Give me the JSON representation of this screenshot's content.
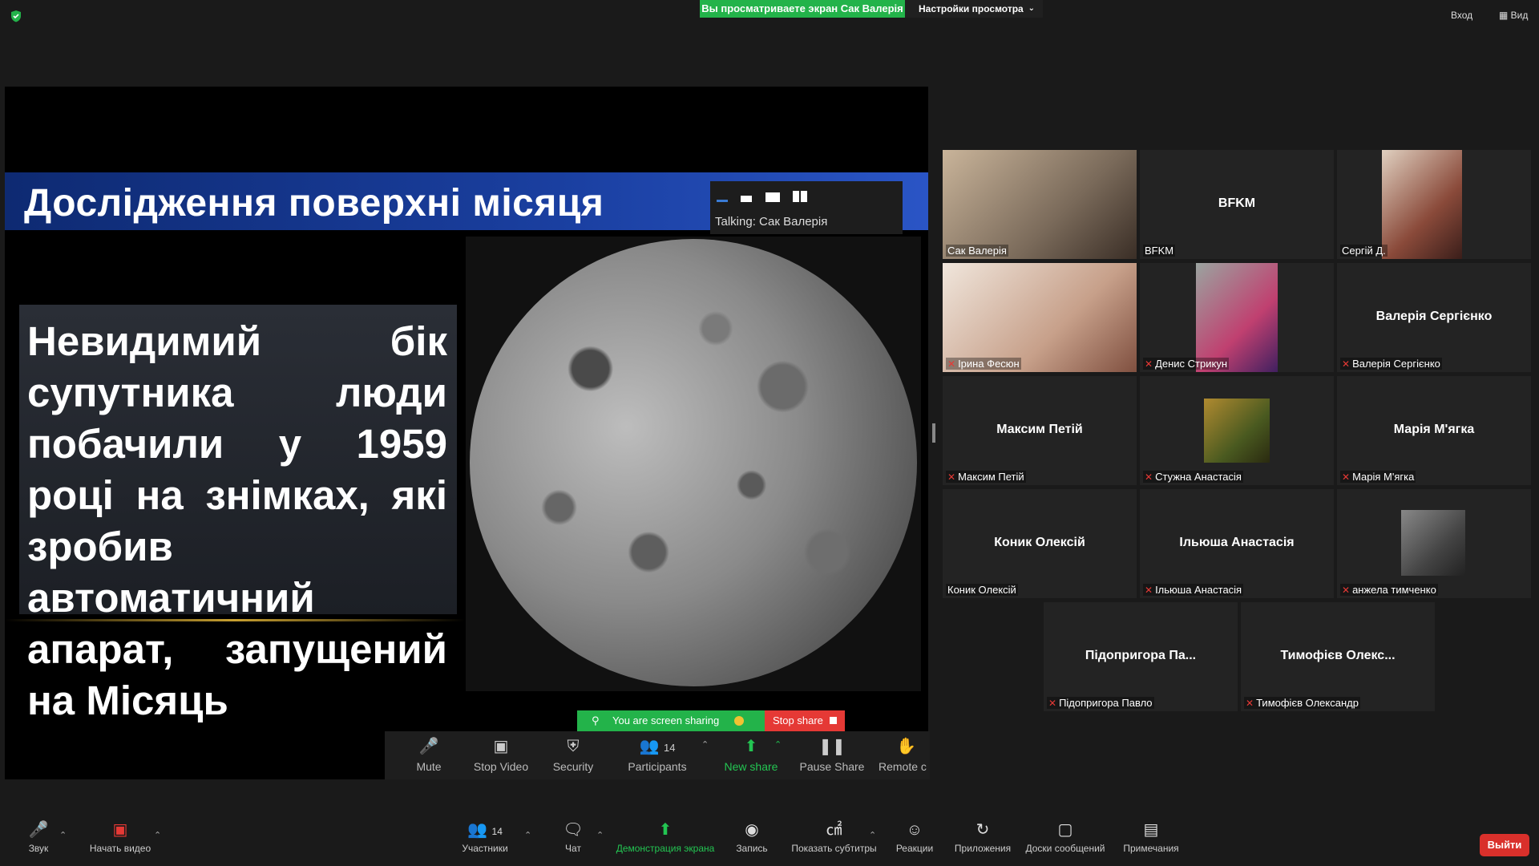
{
  "top": {
    "viewing_banner": "Вы просматриваете экран Сак Валерія",
    "view_options": "Настройки просмотра",
    "exit_fullscreen": "Вход",
    "view": "Вид"
  },
  "slide": {
    "title": "Дослідження поверхні місяця",
    "body": "Невидимий бік супутника люди побачили у 1959 році на знімках, які зробив автоматичний апарат, запущений на Місяць",
    "talking": "Talking: Сак Валерія"
  },
  "share_controls": {
    "sharing_text": "You are screen sharing",
    "stop_share": "Stop share",
    "participants_count": "14",
    "items": [
      "Mute",
      "Stop Video",
      "Security",
      "Participants",
      "New share",
      "Pause Share",
      "Remote c"
    ]
  },
  "gallery": [
    {
      "name": "Сак Валерія",
      "center_name": "",
      "muted": false,
      "video": true,
      "active": true
    },
    {
      "name": "BFKM",
      "center_name": "BFKM",
      "muted": false,
      "video": false,
      "active": false
    },
    {
      "name": "Сергій Д.",
      "center_name": "",
      "muted": false,
      "video": true,
      "active": false
    },
    {
      "name": "Ірина Фесюн",
      "center_name": "",
      "muted": true,
      "video": true,
      "active": false
    },
    {
      "name": "Денис Стрикун",
      "center_name": "",
      "muted": true,
      "video": true,
      "active": false
    },
    {
      "name": "Валерія Сергієнко",
      "center_name": "Валерія Сергієнко",
      "muted": true,
      "video": false,
      "active": false
    },
    {
      "name": "Максим Петій",
      "center_name": "Максим Петій",
      "muted": true,
      "video": false,
      "active": false
    },
    {
      "name": "Стужна Анастасія",
      "center_name": "",
      "muted": true,
      "video": true,
      "active": false
    },
    {
      "name": "Марія М'ягка",
      "center_name": "Марія М'ягка",
      "muted": true,
      "video": false,
      "active": false
    },
    {
      "name": "Коник Олексій",
      "center_name": "Коник Олексій",
      "muted": false,
      "video": false,
      "active": false
    },
    {
      "name": "Ільюша Анастасія",
      "center_name": "Ільюша Анастасія",
      "muted": true,
      "video": false,
      "active": false
    },
    {
      "name": "анжела тимченко",
      "center_name": "",
      "muted": true,
      "video": true,
      "active": false
    },
    {
      "name": "Підопригора Павло",
      "center_name": "Підопригора Па...",
      "muted": true,
      "video": false,
      "active": false
    },
    {
      "name": "Тимофієв Олександр",
      "center_name": "Тимофієв Олекс...",
      "muted": true,
      "video": false,
      "active": false
    }
  ],
  "bottom": {
    "audio": "Звук",
    "video": "Начать видео",
    "participants": "Участники",
    "participants_count": "14",
    "chat": "Чат",
    "share": "Демонстрация экрана",
    "record": "Запись",
    "captions": "Показать субтитры",
    "reactions": "Реакции",
    "apps": "Приложения",
    "whiteboards": "Доски сообщений",
    "notes": "Примечания",
    "leave": "Выйти"
  },
  "colors": {
    "green": "#23b34a",
    "red": "#e53935",
    "active_border": "#b7e05a"
  }
}
